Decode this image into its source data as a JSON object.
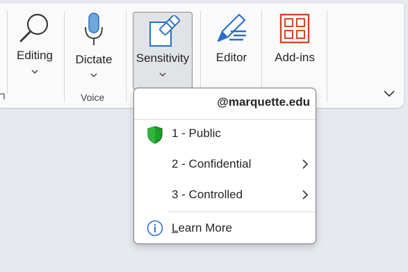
{
  "ribbon": {
    "editing": {
      "label": "Editing",
      "icon": "search-icon"
    },
    "dictate": {
      "label": "Dictate",
      "icon": "microphone-icon"
    },
    "voice_group": "Voice",
    "sensitivity": {
      "label": "Sensitivity",
      "icon": "sensitivity-label-icon"
    },
    "editor": {
      "label": "Editor",
      "icon": "editor-pen-icon"
    },
    "addins": {
      "label": "Add-ins",
      "icon": "add-ins-grid-icon"
    },
    "collapse_icon": "chevron-down-icon"
  },
  "sensitivity_menu": {
    "header": "@marquette.edu",
    "items": [
      {
        "label": "1 - Public",
        "icon": "green-shield-icon",
        "submenu": false
      },
      {
        "label": "2 - Confidential",
        "icon": "",
        "submenu": true
      },
      {
        "label": "3 - Controlled",
        "icon": "",
        "submenu": true
      }
    ],
    "learn_more": {
      "accel": "L",
      "rest": "earn More",
      "icon": "info-icon"
    }
  },
  "colors": {
    "accent_blue": "#2b6fc7",
    "shield_green": "#1e9e2a",
    "addins_orange": "#d24726"
  }
}
